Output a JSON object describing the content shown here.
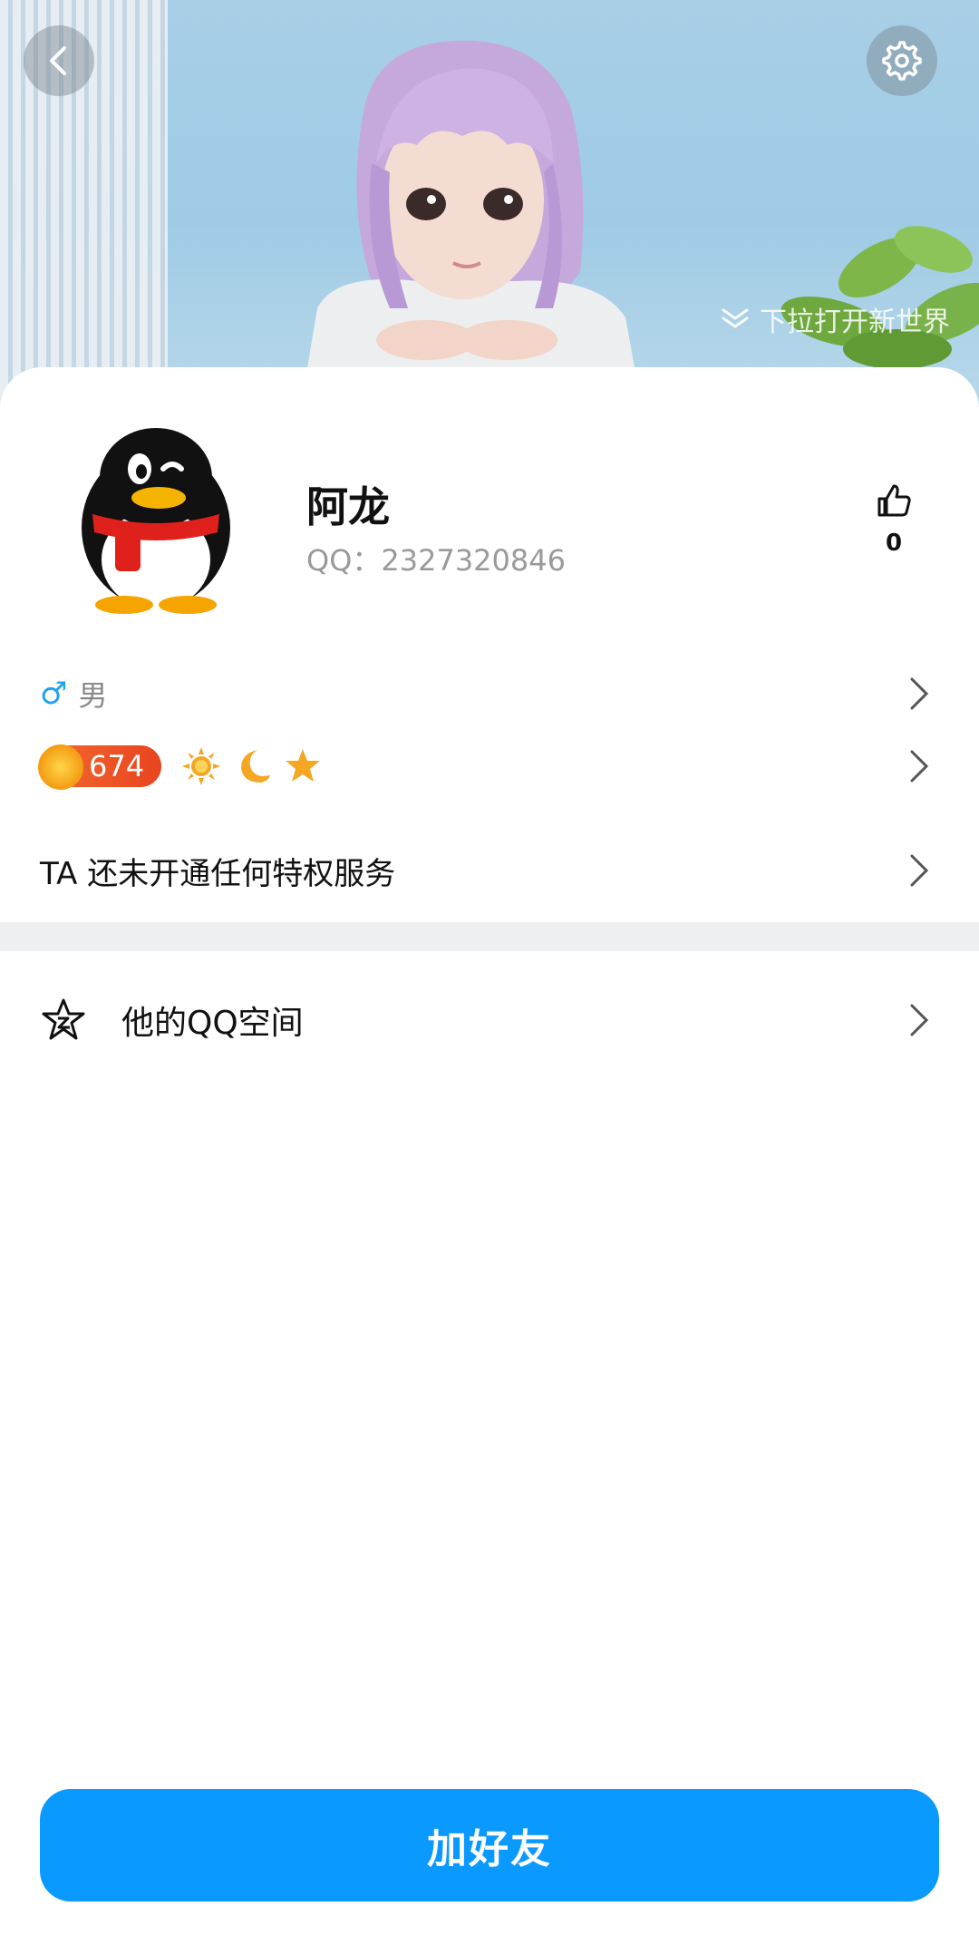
{
  "header": {
    "back_icon": "chevron-left-icon",
    "settings_icon": "gear-icon",
    "pull_hint": "下拉打开新世界"
  },
  "profile": {
    "name": "阿龙",
    "qq_label": "QQ：2327320846",
    "like_count": "0",
    "avatar_icon": "qq-penguin-avatar"
  },
  "info": {
    "gender_symbol": "♂",
    "gender_text": "男",
    "level_value": "674",
    "level_icons": [
      "sun-icon",
      "moon-icon",
      "star-icon"
    ],
    "privilege_text": "TA 还未开通任何特权服务"
  },
  "links": {
    "qzone_label": "他的QQ空间"
  },
  "actions": {
    "add_friend": "加好友"
  },
  "colors": {
    "accent": "#0A99FF",
    "gender_blue": "#1EA3F0",
    "level_orange": "#E9441F"
  }
}
